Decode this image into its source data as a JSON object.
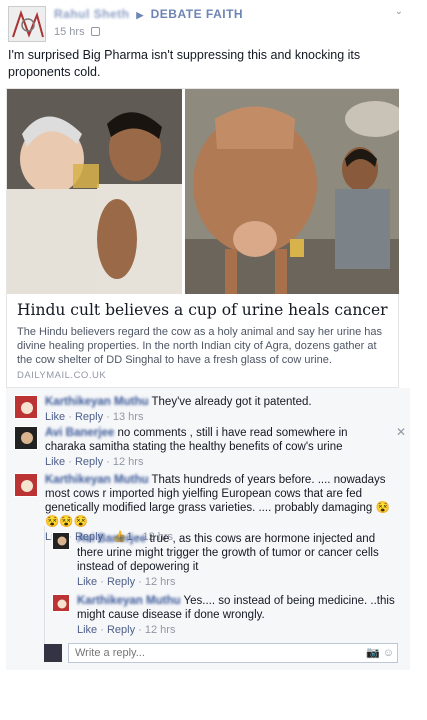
{
  "post": {
    "author": "Rahul Sheth",
    "group": "DEBATE FAITH",
    "time": "15 hrs",
    "text": "I'm surprised Big Pharma isn't suppressing this and knocking its proponents cold."
  },
  "link": {
    "title": "Hindu cult believes a cup of urine heals cancer",
    "description": "The Hindu believers regard the cow as a holy animal and say her urine has divine healing properties. In the north Indian city of Agra, dozens gather at the cow shelter of DD Singhal to have a fresh glass of cow urine.",
    "source": "DAILYMAIL.CO.UK"
  },
  "comments": [
    {
      "author": "Karthikeyan Muthu",
      "text": "They've already got it patented.",
      "like": "Like",
      "reply": "Reply",
      "time": "13 hrs"
    },
    {
      "author": "Avi Banerjee",
      "text": "no comments , still i have read somewhere in charaka samitha stating the healthy benefits of cow's urine",
      "like": "Like",
      "reply": "Reply",
      "time": "12 hrs"
    },
    {
      "author": "Karthikeyan Muthu",
      "text": "Thats hundreds of years before. .... nowadays most cows r imported high yielfing European cows that are fed genetically modified large grass varieties. .... probably damaging 😵😵😵😵",
      "like": "Like",
      "reply": "Reply",
      "likes": "1",
      "time": "12 hrs"
    }
  ],
  "replies": [
    {
      "author": "Avi Banerjee",
      "text": "true , as this cows are hormone injected and there urine might trigger the growth of tumor or cancer cells instead of depowering it",
      "like": "Like",
      "reply": "Reply",
      "time": "12 hrs"
    },
    {
      "author": "Karthikeyan Muthu",
      "text": "Yes.... so instead of being medicine. ..this might cause disease if done wrongly.",
      "like": "Like",
      "reply": "Reply",
      "time": "12 hrs"
    }
  ],
  "reply_box": {
    "placeholder": "Write a reply..."
  },
  "colors": {
    "link_blue": "#3b5998",
    "meta_gray": "#9197a3",
    "comment_bg": "#f6f7f9"
  }
}
